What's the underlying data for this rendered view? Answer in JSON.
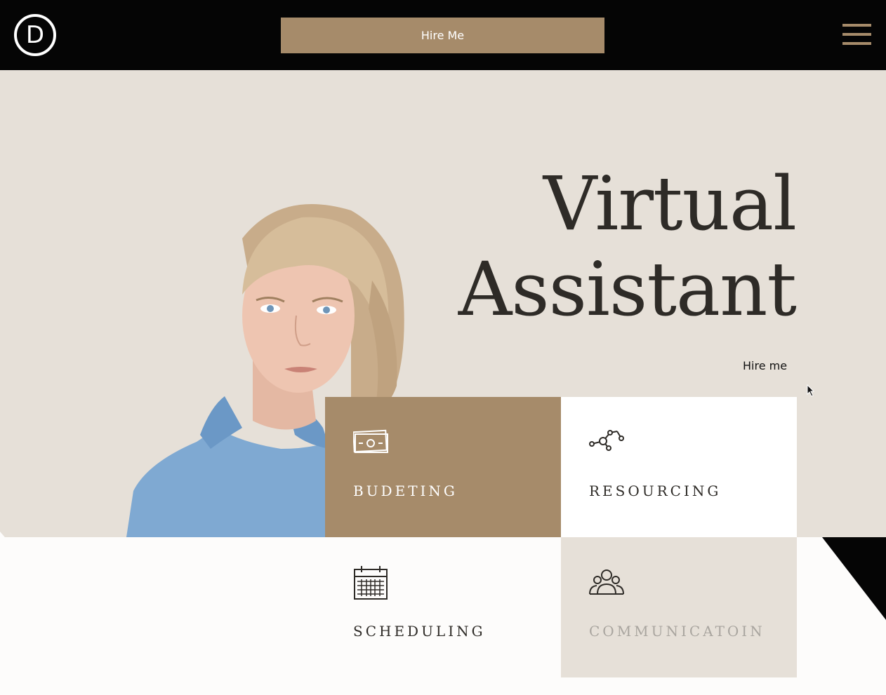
{
  "header": {
    "logo_letter": "D",
    "hire_button_label": "Hire Me",
    "menu_icon": "hamburger-icon"
  },
  "hero": {
    "title_line1": "Virtual",
    "title_line2": "Assistant",
    "hire_link_label": "Hire me"
  },
  "services": [
    {
      "label": "BUDETING",
      "icon": "money-bill-icon"
    },
    {
      "label": "RESOURCING",
      "icon": "network-nodes-icon"
    },
    {
      "label": "SCHEDULING",
      "icon": "calendar-icon"
    },
    {
      "label": "COMMUNICATOIN",
      "icon": "people-group-icon"
    }
  ],
  "colors": {
    "accent": "#a68b6a",
    "header_bg": "#050505",
    "hero_bg": "#e6e0d8",
    "text_dark": "#2e2b27",
    "text_muted": "#a9a59f"
  }
}
